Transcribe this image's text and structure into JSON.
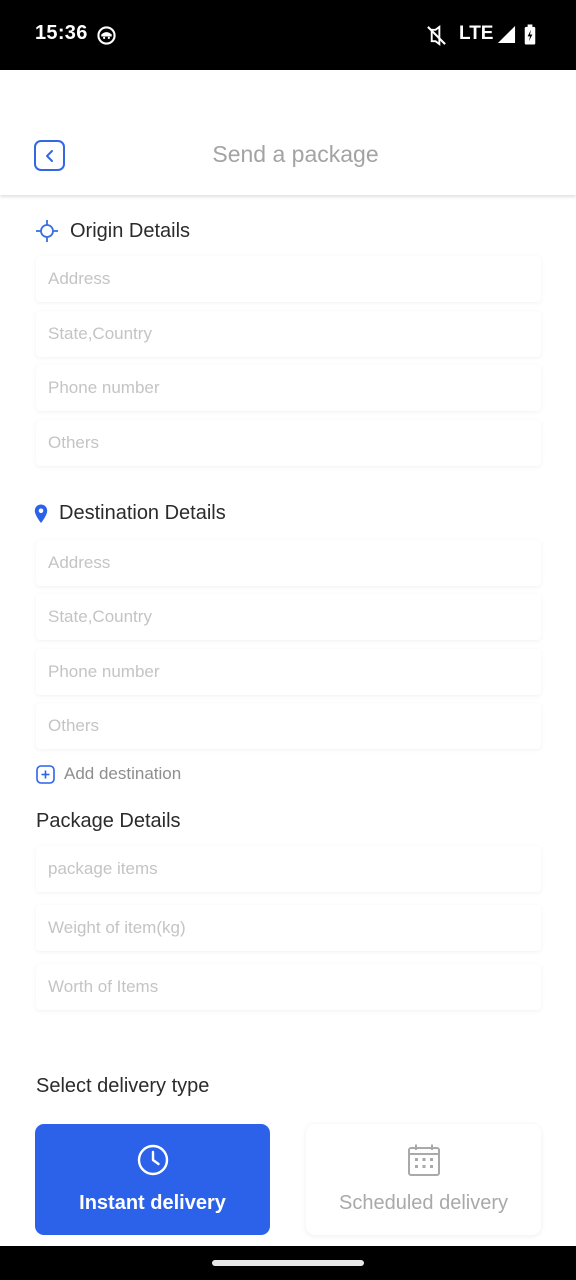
{
  "status_bar": {
    "time": "15:36",
    "network": "LTE"
  },
  "header": {
    "title": "Send a package"
  },
  "origin": {
    "title": "Origin Details",
    "fields": [
      {
        "placeholder": "Address"
      },
      {
        "placeholder": "State,Country"
      },
      {
        "placeholder": "Phone number"
      },
      {
        "placeholder": "Others"
      }
    ]
  },
  "destination": {
    "title": "Destination Details",
    "fields": [
      {
        "placeholder": "Address"
      },
      {
        "placeholder": "State,Country"
      },
      {
        "placeholder": "Phone number"
      },
      {
        "placeholder": "Others"
      }
    ],
    "add_label": "Add destination"
  },
  "package": {
    "title": "Package Details",
    "fields": [
      {
        "placeholder": "package items"
      },
      {
        "placeholder": "Weight of item(kg)"
      },
      {
        "placeholder": "Worth of Items"
      }
    ]
  },
  "delivery": {
    "title": "Select delivery type",
    "options": [
      {
        "label": "Instant delivery",
        "icon": "clock-icon",
        "selected": true
      },
      {
        "label": "Scheduled delivery",
        "icon": "calendar-icon",
        "selected": false
      }
    ]
  },
  "colors": {
    "accent": "#2c62ea",
    "title_gray": "#a3a3a3",
    "placeholder": "#c4c4c4"
  }
}
